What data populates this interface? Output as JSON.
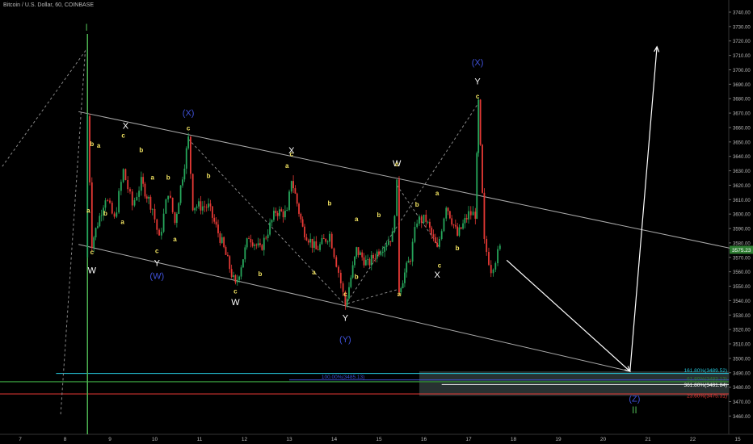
{
  "header": {
    "symbol_line": "Bitcoin / U.S. Dollar, 60, COINBASE"
  },
  "colors": {
    "background": "#000000",
    "up": "#26a65b",
    "down": "#e53935",
    "channel": "#aaaaaa",
    "wave_white": "#ffffff",
    "wave_yellow": "#f5e663",
    "wave_blue": "#3f51d8",
    "wave_green": "#4caf50",
    "fib_cyan": "#26c6da",
    "fib_green": "#2e7d32",
    "fib_blue": "#3f51d8",
    "fib_red": "#e53935",
    "last_price_bg": "#2e7d32"
  },
  "chart_data": {
    "type": "candlestick",
    "ylim": [
      3455,
      3745
    ],
    "xlim": [
      6.5,
      16.2
    ],
    "x_ticks": [
      {
        "x": 7,
        "label": "7"
      },
      {
        "x": 8,
        "label": "8"
      },
      {
        "x": 9,
        "label": "9"
      },
      {
        "x": 10,
        "label": "10"
      },
      {
        "x": 11,
        "label": "11"
      },
      {
        "x": 12,
        "label": "12"
      },
      {
        "x": 13,
        "label": "13"
      },
      {
        "x": 14,
        "label": "14"
      },
      {
        "x": 15,
        "label": "15"
      },
      {
        "x": 16,
        "label": "16"
      },
      {
        "x": 17,
        "label": "17"
      },
      {
        "x": 18,
        "label": "18"
      },
      {
        "x": 19,
        "label": "19"
      },
      {
        "x": 20,
        "label": "20"
      },
      {
        "x": 21,
        "label": "21"
      },
      {
        "x": 22,
        "label": "22"
      },
      {
        "x": 23,
        "label": "15"
      },
      {
        "x": 24,
        "label": "16"
      }
    ],
    "y_ticks": [
      "3740.00",
      "3730.00",
      "3720.00",
      "3710.00",
      "3700.00",
      "3690.00",
      "3680.00",
      "3670.00",
      "3660.00",
      "3650.00",
      "3640.00",
      "3630.00",
      "3620.00",
      "3610.00",
      "3600.00",
      "3590.00",
      "3580.00",
      "3570.00",
      "3560.00",
      "3550.00",
      "3540.00",
      "3530.00",
      "3520.00",
      "3510.00",
      "3500.00",
      "3490.00",
      "3480.00",
      "3470.00",
      "3460.00"
    ],
    "last_price": "3575.23",
    "waypoints": [
      [
        8.45,
        3570
      ],
      [
        8.5,
        3668
      ],
      [
        8.6,
        3580
      ],
      [
        8.9,
        3612
      ],
      [
        9.1,
        3596
      ],
      [
        9.3,
        3630
      ],
      [
        9.5,
        3606
      ],
      [
        9.7,
        3622
      ],
      [
        9.95,
        3604
      ],
      [
        10.1,
        3582
      ],
      [
        10.3,
        3616
      ],
      [
        10.45,
        3594
      ],
      [
        10.75,
        3652
      ],
      [
        10.85,
        3606
      ],
      [
        11.2,
        3605
      ],
      [
        11.5,
        3580
      ],
      [
        11.8,
        3550
      ],
      [
        12.1,
        3585
      ],
      [
        12.35,
        3575
      ],
      [
        12.7,
        3602
      ],
      [
        12.95,
        3600
      ],
      [
        13.05,
        3625
      ],
      [
        13.3,
        3590
      ],
      [
        13.6,
        3575
      ],
      [
        13.9,
        3586
      ],
      [
        14.1,
        3560
      ],
      [
        14.25,
        3537
      ],
      [
        14.5,
        3575
      ],
      [
        14.75,
        3565
      ],
      [
        15.0,
        3575
      ],
      [
        15.3,
        3585
      ],
      [
        15.4,
        3620
      ],
      [
        15.45,
        3548
      ],
      [
        15.7,
        3570
      ],
      [
        15.85,
        3596
      ],
      [
        16.05,
        3596
      ],
      [
        16.3,
        3575
      ],
      [
        16.5,
        3607
      ],
      [
        16.75,
        3585
      ],
      [
        17.0,
        3600
      ],
      [
        17.15,
        3600
      ],
      [
        17.22,
        3677
      ],
      [
        17.35,
        3580
      ],
      [
        17.5,
        3562
      ],
      [
        17.7,
        3576
      ]
    ],
    "channel_upper": [
      [
        8.3,
        3671
      ],
      [
        23.5,
        3572
      ]
    ],
    "channel_lower": [
      [
        8.3,
        3579
      ],
      [
        20.6,
        3491
      ]
    ],
    "projection": [
      [
        17.85,
        3568
      ],
      [
        20.6,
        3491
      ],
      [
        21.2,
        3716
      ]
    ],
    "dotted_paths": [
      [
        [
          6.6,
          3633
        ],
        [
          8.45,
          3713
        ],
        [
          7.9,
          3460
        ]
      ],
      [
        [
          10.75,
          3652
        ],
        [
          14.25,
          3537
        ],
        [
          17.22,
          3677
        ]
      ],
      [
        [
          15.4,
          3620
        ],
        [
          16.35,
          3577
        ]
      ],
      [
        [
          14.3,
          3538
        ],
        [
          15.45,
          3548
        ]
      ]
    ],
    "vertical_marker": {
      "x": 8.5,
      "color": "green"
    },
    "fib_levels": [
      {
        "value": 3489.52,
        "label": "161.80%(3489.52)",
        "color": "cyan",
        "x_start": 7.8
      },
      {
        "value": 3485.0,
        "label": "100.00%(3485.13)",
        "color": "blue",
        "x_start": 13.0
      },
      {
        "value": 3483.8,
        "label": "61.80%(3483.13)",
        "color": "green",
        "x_start": 6.5
      },
      {
        "value": 3481.84,
        "label": "361.80%(3481.84)",
        "color": "white",
        "x_start": 16.4
      },
      {
        "value": 3475.31,
        "label": "23.60%(3475.31)",
        "color": "red",
        "x_start": 6.5
      }
    ],
    "fib_zone": {
      "x_start": 15.9,
      "y_top": 3491,
      "y_bottom": 3474
    },
    "wave_labels": [
      {
        "text": "I",
        "x": 8.48,
        "y": 3727,
        "color": "green",
        "size": 12
      },
      {
        "text": "II",
        "x": 20.7,
        "y": 3462,
        "color": "green",
        "size": 12
      },
      {
        "text": "(Z)",
        "x": 20.7,
        "y": 3470,
        "color": "blue",
        "size": 11
      },
      {
        "text": "W",
        "x": 8.6,
        "y": 3559,
        "color": "white",
        "size": 11
      },
      {
        "text": "X",
        "x": 9.35,
        "y": 3659,
        "color": "white",
        "size": 11
      },
      {
        "text": "Y",
        "x": 10.05,
        "y": 3564,
        "color": "white",
        "size": 11
      },
      {
        "text": "(W)",
        "x": 10.05,
        "y": 3555,
        "color": "blue",
        "size": 11
      },
      {
        "text": "(X)",
        "x": 10.75,
        "y": 3668,
        "color": "blue",
        "size": 11
      },
      {
        "text": "W",
        "x": 11.8,
        "y": 3537,
        "color": "white",
        "size": 11
      },
      {
        "text": "X",
        "x": 13.05,
        "y": 3642,
        "color": "white",
        "size": 11
      },
      {
        "text": "Y",
        "x": 14.25,
        "y": 3526,
        "color": "white",
        "size": 11
      },
      {
        "text": "(Y)",
        "x": 14.25,
        "y": 3511,
        "color": "blue",
        "size": 11
      },
      {
        "text": "W",
        "x": 15.4,
        "y": 3633,
        "color": "white",
        "size": 11
      },
      {
        "text": "X",
        "x": 16.3,
        "y": 3556,
        "color": "white",
        "size": 11
      },
      {
        "text": "(X)",
        "x": 17.2,
        "y": 3703,
        "color": "blue",
        "size": 11
      },
      {
        "text": "Y",
        "x": 17.2,
        "y": 3690,
        "color": "white",
        "size": 11
      },
      {
        "text": "b",
        "x": 8.6,
        "y": 3647,
        "color": "yellow",
        "size": 8
      },
      {
        "text": "a",
        "x": 8.75,
        "y": 3646,
        "color": "yellow",
        "size": 8
      },
      {
        "text": "a",
        "x": 8.52,
        "y": 3601,
        "color": "yellow",
        "size": 8
      },
      {
        "text": "b",
        "x": 8.9,
        "y": 3599,
        "color": "yellow",
        "size": 8
      },
      {
        "text": "c",
        "x": 8.6,
        "y": 3572,
        "color": "yellow",
        "size": 8
      },
      {
        "text": "c",
        "x": 9.3,
        "y": 3653,
        "color": "yellow",
        "size": 8
      },
      {
        "text": "a",
        "x": 9.28,
        "y": 3593,
        "color": "yellow",
        "size": 8
      },
      {
        "text": "b",
        "x": 9.7,
        "y": 3643,
        "color": "yellow",
        "size": 8
      },
      {
        "text": "a",
        "x": 9.95,
        "y": 3624,
        "color": "yellow",
        "size": 8
      },
      {
        "text": "b",
        "x": 10.3,
        "y": 3624,
        "color": "yellow",
        "size": 8
      },
      {
        "text": "c",
        "x": 10.05,
        "y": 3573,
        "color": "yellow",
        "size": 8
      },
      {
        "text": "a",
        "x": 10.45,
        "y": 3581,
        "color": "yellow",
        "size": 8
      },
      {
        "text": "c",
        "x": 10.75,
        "y": 3658,
        "color": "yellow",
        "size": 8
      },
      {
        "text": "b",
        "x": 11.2,
        "y": 3625,
        "color": "yellow",
        "size": 8
      },
      {
        "text": "c",
        "x": 11.8,
        "y": 3545,
        "color": "yellow",
        "size": 8
      },
      {
        "text": "a",
        "x": 12.95,
        "y": 3632,
        "color": "yellow",
        "size": 8
      },
      {
        "text": "c",
        "x": 13.05,
        "y": 3640,
        "color": "yellow",
        "size": 8
      },
      {
        "text": "b",
        "x": 12.35,
        "y": 3557,
        "color": "yellow",
        "size": 8
      },
      {
        "text": "b",
        "x": 13.9,
        "y": 3606,
        "color": "yellow",
        "size": 8
      },
      {
        "text": "a",
        "x": 13.55,
        "y": 3558,
        "color": "yellow",
        "size": 8
      },
      {
        "text": "c",
        "x": 14.25,
        "y": 3543,
        "color": "yellow",
        "size": 8
      },
      {
        "text": "a",
        "x": 14.5,
        "y": 3595,
        "color": "yellow",
        "size": 8
      },
      {
        "text": "b",
        "x": 14.5,
        "y": 3555,
        "color": "yellow",
        "size": 8
      },
      {
        "text": "b",
        "x": 15.0,
        "y": 3598,
        "color": "yellow",
        "size": 8
      },
      {
        "text": "c",
        "x": 15.4,
        "y": 3633,
        "color": "yellow",
        "size": 8
      },
      {
        "text": "a",
        "x": 15.45,
        "y": 3543,
        "color": "yellow",
        "size": 8
      },
      {
        "text": "b",
        "x": 15.85,
        "y": 3605,
        "color": "yellow",
        "size": 8
      },
      {
        "text": "a",
        "x": 16.3,
        "y": 3613,
        "color": "yellow",
        "size": 8
      },
      {
        "text": "c",
        "x": 16.35,
        "y": 3563,
        "color": "yellow",
        "size": 8
      },
      {
        "text": "b",
        "x": 16.75,
        "y": 3575,
        "color": "yellow",
        "size": 8
      },
      {
        "text": "c",
        "x": 17.2,
        "y": 3680,
        "color": "yellow",
        "size": 8
      }
    ]
  }
}
